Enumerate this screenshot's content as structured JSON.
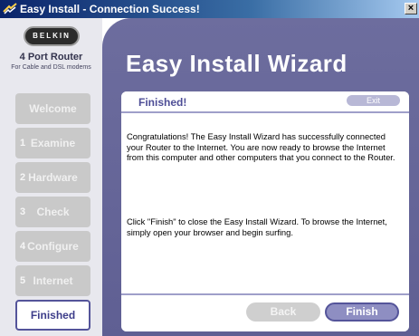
{
  "window": {
    "title": "Easy Install - Connection Success!",
    "close_symbol": "×"
  },
  "brand": {
    "logo_text": "BELKIN",
    "product_name": "4 Port Router",
    "product_sub": "For Cable and DSL modems"
  },
  "steps": [
    {
      "num": "",
      "label": "Welcome",
      "active": false
    },
    {
      "num": "1",
      "label": "Examine",
      "active": false
    },
    {
      "num": "2",
      "label": "Hardware",
      "active": false
    },
    {
      "num": "3",
      "label": "Check",
      "active": false
    },
    {
      "num": "4",
      "label": "Configure",
      "active": false
    },
    {
      "num": "5",
      "label": "Internet",
      "active": false
    },
    {
      "num": "",
      "label": "Finished",
      "active": true
    }
  ],
  "main": {
    "title": "Easy Install Wizard"
  },
  "panel": {
    "heading": "Finished!",
    "exit_label": "Exit",
    "paragraph1": "Congratulations! The Easy Install Wizard has successfully connected your Router to the Internet. You are now ready to browse the Internet from this computer and other computers that you connect to the Router.",
    "paragraph2": "Click \"Finish\" to close the Easy Install Wizard. To browse the Internet, simply open your browser and begin surfing.",
    "back_label": "Back",
    "finish_label": "Finish"
  },
  "colors": {
    "accent": "#5f5f93",
    "heading": "#4e4e96"
  }
}
